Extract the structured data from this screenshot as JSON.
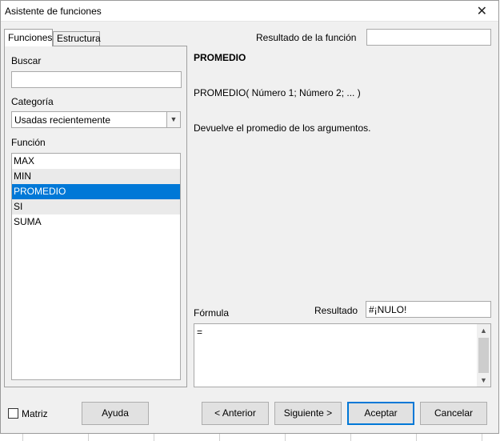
{
  "window": {
    "title": "Asistente de funciones",
    "close_glyph": "✕"
  },
  "tabs": [
    {
      "label": "Funciones",
      "active": true
    },
    {
      "label": "Estructura",
      "active": false
    }
  ],
  "left": {
    "search_label": "Buscar",
    "search_value": "",
    "category_label": "Categoría",
    "category_value": "Usadas recientemente",
    "function_label": "Función",
    "functions": [
      "MAX",
      "MIN",
      "PROMEDIO",
      "SI",
      "SUMA"
    ],
    "selected_function": "PROMEDIO"
  },
  "right": {
    "result_label": "Resultado de la función",
    "result_value": "",
    "function_name": "PROMEDIO",
    "signature": "PROMEDIO( Número 1; Número 2; ... )",
    "description": "Devuelve el promedio de los argumentos.",
    "formula_label": "Fórmula",
    "result2_label": "Resultado",
    "result2_value": "#¡NULO!",
    "formula_value": "="
  },
  "footer": {
    "matrix_label": "Matriz",
    "matrix_checked": false,
    "help_label": "Ayuda",
    "prev_label": "< Anterior",
    "next_label": "Siguiente >",
    "ok_label": "Aceptar",
    "cancel_label": "Cancelar"
  },
  "colors": {
    "selection": "#0078d7",
    "dialog_bg": "#f0f0f0"
  }
}
